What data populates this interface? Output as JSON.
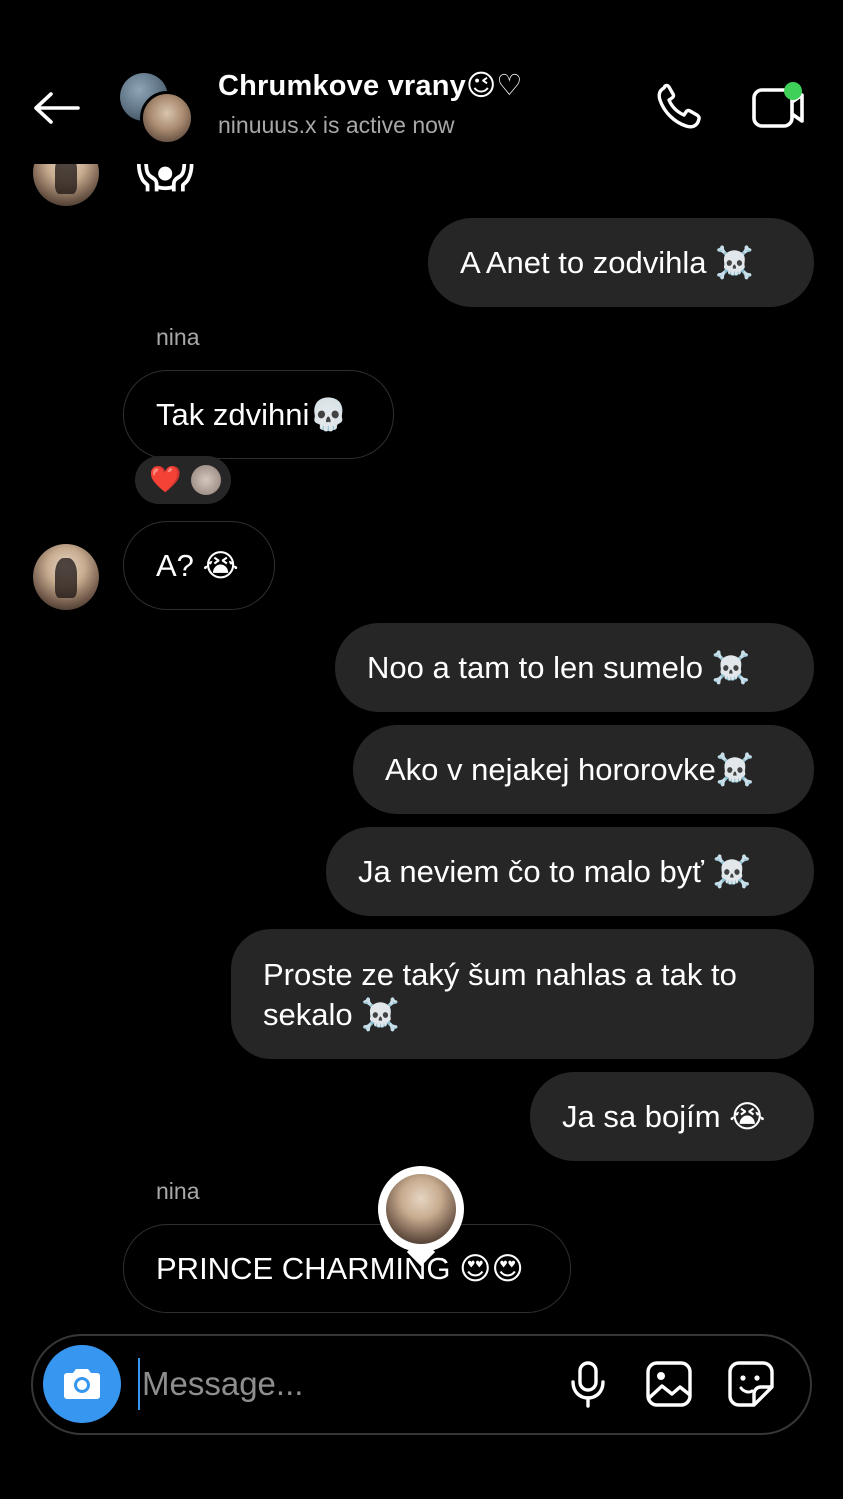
{
  "header": {
    "title": "Chrumkove vrany😉♡",
    "subtitle": "ninuuus.x is active now"
  },
  "messages": [
    {
      "from": "me",
      "text": "A Anet to zodvihla ☠️"
    },
    {
      "from": "nina",
      "sender": "nina",
      "text": "Tak zdvihni💀",
      "reaction": "❤️"
    },
    {
      "from": "nina",
      "text": "A? 😭"
    },
    {
      "from": "me",
      "text": "Noo a tam to len sumelo ☠️"
    },
    {
      "from": "me",
      "text": "Ako v nejakej hororovke☠️"
    },
    {
      "from": "me",
      "text": "Ja neviem čo to malo byť ☠️"
    },
    {
      "from": "me",
      "text": "Proste ze taký šum nahlas a tak to sekalo ☠️"
    },
    {
      "from": "me",
      "text": "Ja sa bojím 😭"
    },
    {
      "from": "nina",
      "sender": "nina",
      "text": "PRINCE CHARMING 😍😍"
    }
  ],
  "composer": {
    "placeholder": "Message..."
  },
  "colors": {
    "accent": "#3797f0",
    "online": "#3fd05a",
    "outgoing_bubble": "#262626"
  },
  "icons": [
    "back-arrow-icon",
    "phone-icon",
    "video-icon",
    "camera-icon",
    "microphone-icon",
    "gallery-icon",
    "sticker-icon"
  ]
}
